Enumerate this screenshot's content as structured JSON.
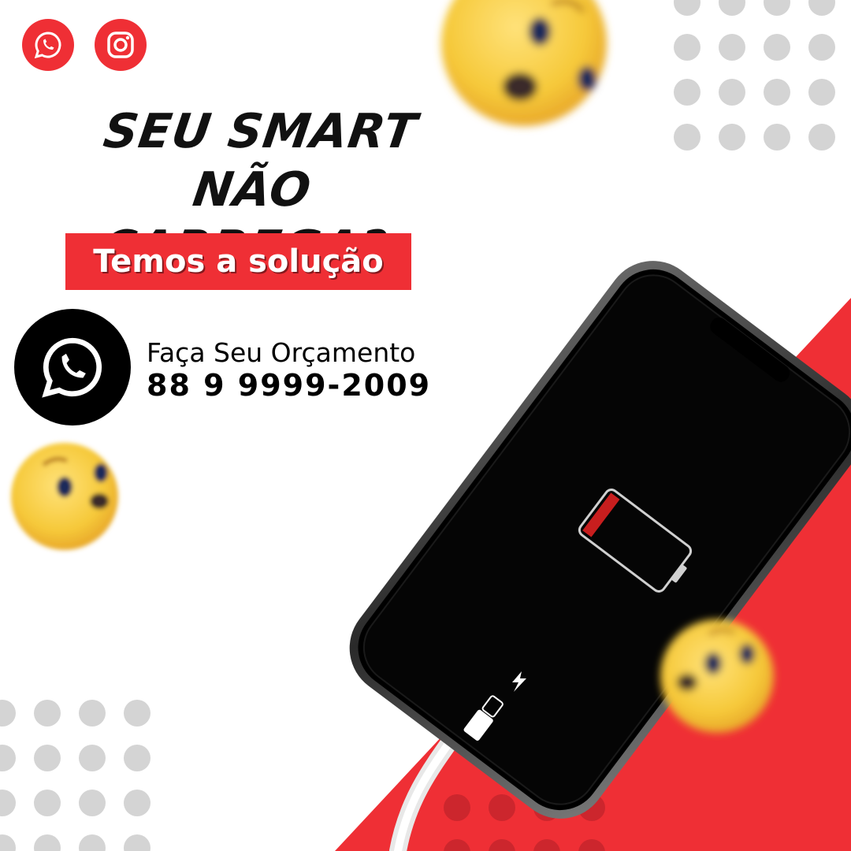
{
  "social": {
    "whatsapp_icon": "whatsapp-icon",
    "instagram_icon": "instagram-icon"
  },
  "headline": {
    "line1": "SEU SMART NÃO",
    "line2": "CARREGA?"
  },
  "banner": {
    "text": "Temos a solução"
  },
  "contact": {
    "icon": "whatsapp-icon",
    "label": "Faça Seu Orçamento",
    "phone": "88 9 9999-2009"
  },
  "colors": {
    "accent_red": "#ef2f35",
    "text_dark": "#000000",
    "dots_gray": "#d4d4d4",
    "emoji_yellow": "#f6c93a",
    "background": "#ffffff"
  },
  "decorations": {
    "emoji": "surprised-face-emoji",
    "phone": "smartphone-low-battery",
    "cable": "charging-cable"
  }
}
